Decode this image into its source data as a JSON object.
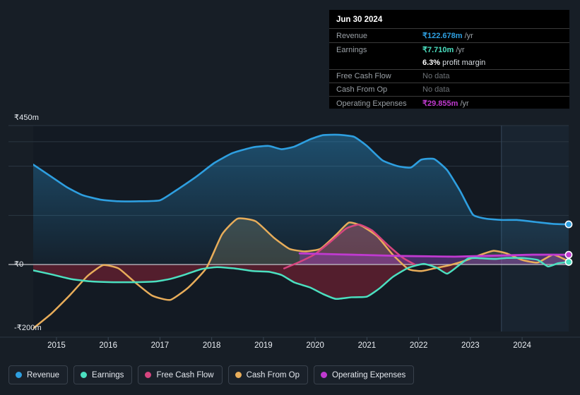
{
  "theme": {
    "background": "#171e26",
    "plot_bg": "#131a23",
    "forecast_bg": "#18222e",
    "gridline": "#2b3742",
    "zero_line": "#c9ccd1"
  },
  "tooltip": {
    "title": "Jun 30 2024",
    "rows": [
      {
        "key": "Revenue",
        "value": "₹122.678m",
        "unit": "/yr",
        "color": "#2e9fe0",
        "no_data": false
      },
      {
        "key": "Earnings",
        "value": "₹7.710m",
        "unit": "/yr",
        "color": "#4be0c0",
        "no_data": false
      },
      {
        "key": "",
        "value": "6.3%",
        "unit": "profit margin",
        "color": "#ffffff",
        "no_data": false,
        "is_margin": true
      },
      {
        "key": "Free Cash Flow",
        "value": "No data",
        "unit": "",
        "color": "#6d7277",
        "no_data": true
      },
      {
        "key": "Cash From Op",
        "value": "No data",
        "unit": "",
        "color": "#6d7277",
        "no_data": true
      },
      {
        "key": "Operating Expenses",
        "value": "₹29.855m",
        "unit": "/yr",
        "color": "#c03ad0",
        "no_data": false
      }
    ]
  },
  "legend": {
    "items": [
      {
        "label": "Revenue",
        "color": "#2e9fe0"
      },
      {
        "label": "Earnings",
        "color": "#4be0c0"
      },
      {
        "label": "Free Cash Flow",
        "color": "#d6457f"
      },
      {
        "label": "Cash From Op",
        "color": "#e8ad5a"
      },
      {
        "label": "Operating Expenses",
        "color": "#c03ad0"
      }
    ]
  },
  "chart_data": {
    "type": "area",
    "title": "",
    "xlabel": "",
    "ylabel": "",
    "currency": "INR",
    "unit": "m",
    "ylim": [
      -200,
      450
    ],
    "y_ticks": [
      {
        "label": "₹450m",
        "value": 450
      },
      {
        "label": "₹0",
        "value": 0
      },
      {
        "label": "-₹200m",
        "value": -200
      }
    ],
    "gridlines": [
      450,
      375,
      300,
      150
    ],
    "grid": true,
    "legend_position": "bottom-left",
    "x_ticks": [
      "2015",
      "2016",
      "2017",
      "2018",
      "2019",
      "2020",
      "2021",
      "2022",
      "2023",
      "2024"
    ],
    "x_range": [
      2014.55,
      2024.9
    ],
    "forecast_start": 2023.6,
    "series": [
      {
        "name": "Revenue",
        "color": "#2e9fe0",
        "fill": true,
        "x": [
          2014.55,
          2014.9,
          2015.2,
          2015.5,
          2015.85,
          2016.2,
          2016.6,
          2017.0,
          2017.3,
          2017.7,
          2018.05,
          2018.4,
          2018.8,
          2019.1,
          2019.35,
          2019.6,
          2019.9,
          2020.15,
          2020.45,
          2020.75,
          2021.0,
          2021.3,
          2021.6,
          2021.85,
          2022.05,
          2022.3,
          2022.55,
          2022.8,
          2023.05,
          2023.3,
          2023.6,
          2023.9,
          2024.25,
          2024.6,
          2024.9
        ],
        "y": [
          305,
          268,
          236,
          212,
          198,
          193,
          193,
          196,
          225,
          268,
          310,
          340,
          358,
          362,
          352,
          360,
          382,
          395,
          396,
          390,
          362,
          318,
          300,
          296,
          320,
          322,
          288,
          225,
          152,
          140,
          136,
          136,
          130,
          124,
          122.678
        ]
      },
      {
        "name": "Earnings",
        "color": "#4be0c0",
        "fill": true,
        "x": [
          2014.55,
          2014.9,
          2015.3,
          2015.7,
          2016.1,
          2016.5,
          2016.9,
          2017.2,
          2017.5,
          2017.8,
          2018.1,
          2018.45,
          2018.8,
          2019.1,
          2019.35,
          2019.6,
          2019.9,
          2020.15,
          2020.4,
          2020.7,
          2021.0,
          2021.25,
          2021.5,
          2021.8,
          2022.1,
          2022.35,
          2022.55,
          2022.75,
          2022.95,
          2023.1,
          2023.3,
          2023.5,
          2023.7,
          2024.0,
          2024.3,
          2024.5,
          2024.7,
          2024.9
        ],
        "y": [
          -18,
          -30,
          -45,
          -52,
          -54,
          -54,
          -52,
          -44,
          -30,
          -14,
          -8,
          -12,
          -20,
          -22,
          -32,
          -55,
          -70,
          -90,
          -105,
          -100,
          -98,
          -72,
          -38,
          -10,
          2,
          -10,
          -28,
          -6,
          18,
          20,
          18,
          17,
          20,
          20,
          14,
          -6,
          4,
          7.71
        ]
      },
      {
        "name": "Free Cash Flow",
        "color": "#d6457f",
        "fill": false,
        "x": [
          2019.4,
          2019.7,
          2020.0,
          2020.3,
          2020.6,
          2020.85,
          2021.1,
          2021.4,
          2021.7,
          2021.95
        ],
        "y": [
          -12,
          8,
          32,
          70,
          110,
          122,
          104,
          60,
          20,
          -2
        ]
      },
      {
        "name": "Cash From Op",
        "color": "#e8ad5a",
        "fill": true,
        "x": [
          2014.55,
          2014.9,
          2015.25,
          2015.6,
          2015.9,
          2016.2,
          2016.5,
          2016.85,
          2017.2,
          2017.55,
          2017.9,
          2018.2,
          2018.5,
          2018.85,
          2019.2,
          2019.5,
          2019.8,
          2020.1,
          2020.4,
          2020.65,
          2020.9,
          2021.2,
          2021.5,
          2021.8,
          2022.05,
          2022.3,
          2022.6,
          2022.9,
          2023.2,
          2023.45,
          2023.7,
          2024.0,
          2024.3,
          2024.6,
          2024.9
        ],
        "y": [
          -195,
          -150,
          -95,
          -35,
          -2,
          -12,
          -52,
          -95,
          -108,
          -70,
          -10,
          92,
          140,
          132,
          82,
          48,
          40,
          48,
          90,
          128,
          118,
          86,
          30,
          -14,
          -20,
          -12,
          -2,
          12,
          30,
          42,
          34,
          14,
          6,
          30,
          10
        ]
      },
      {
        "name": "Operating Expenses",
        "color": "#c03ad0",
        "fill": true,
        "x": [
          2019.7,
          2020.2,
          2020.7,
          2021.2,
          2021.7,
          2022.2,
          2022.7,
          2023.2,
          2023.7,
          2024.2,
          2024.9
        ],
        "y": [
          34,
          32,
          30,
          28,
          26,
          25,
          24,
          26,
          28,
          30,
          29.855
        ]
      }
    ]
  }
}
